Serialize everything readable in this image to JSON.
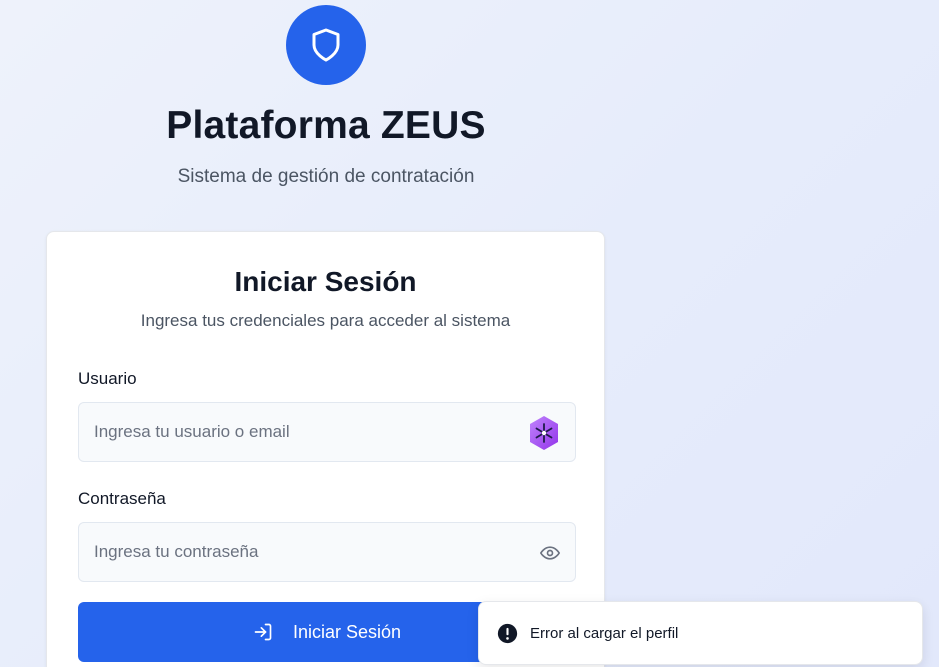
{
  "brand": {
    "logo_icon": "shield-icon",
    "title": "Plataforma ZEUS",
    "subtitle": "Sistema de gestión de contratación"
  },
  "login": {
    "title": "Iniciar Sesión",
    "subtitle": "Ingresa tus credenciales para acceder al sistema",
    "username": {
      "label": "Usuario",
      "value": "",
      "placeholder": "Ingresa tu usuario o email",
      "trailing_icon": "password-manager-extension-icon"
    },
    "password": {
      "label": "Contraseña",
      "value": "",
      "placeholder": "Ingresa tu contraseña",
      "trailing_icon": "eye-icon"
    },
    "submit": {
      "label": "Iniciar Sesión",
      "icon": "login-icon"
    }
  },
  "toast": {
    "icon": "alert-circle-icon",
    "message": "Error al cargar el perfil"
  },
  "colors": {
    "primary": "#2563eb",
    "background": "#eef2fb",
    "text": "#111827",
    "muted": "#4b5563"
  }
}
